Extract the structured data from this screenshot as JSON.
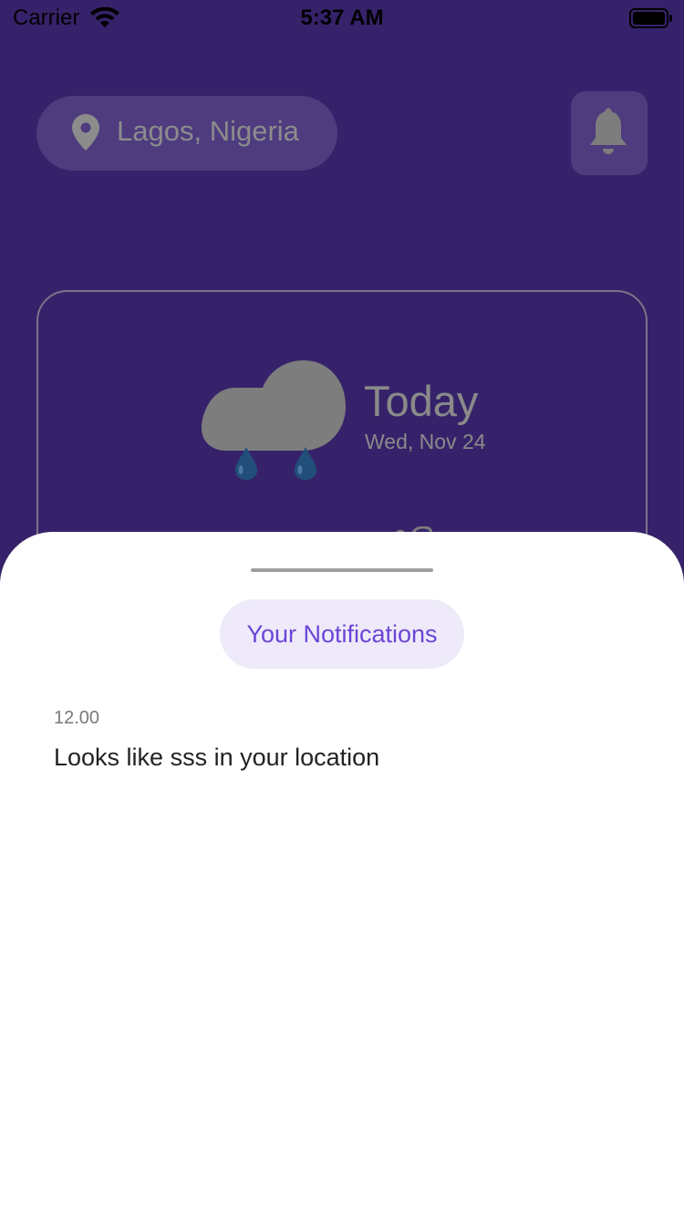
{
  "status_bar": {
    "carrier": "Carrier",
    "time": "5:37 AM",
    "icons": [
      "wifi-icon",
      "battery-icon"
    ]
  },
  "header": {
    "location": "Lagos, Nigeria",
    "location_icon": "location-pin-icon",
    "notification_icon": "bell-icon"
  },
  "weather_card": {
    "icon": "rain-cloud-icon",
    "day": "Today",
    "date": "Wed, Nov 24"
  },
  "notifications_sheet": {
    "title": "Your Notifications",
    "items": [
      {
        "time": "12.00",
        "message": "Looks like sss in your location"
      }
    ]
  },
  "colors": {
    "background": "#36226a",
    "accent": "#6b45d6",
    "pill_background": "#eeeafa",
    "dimmed_text": "#8a8a8a"
  }
}
